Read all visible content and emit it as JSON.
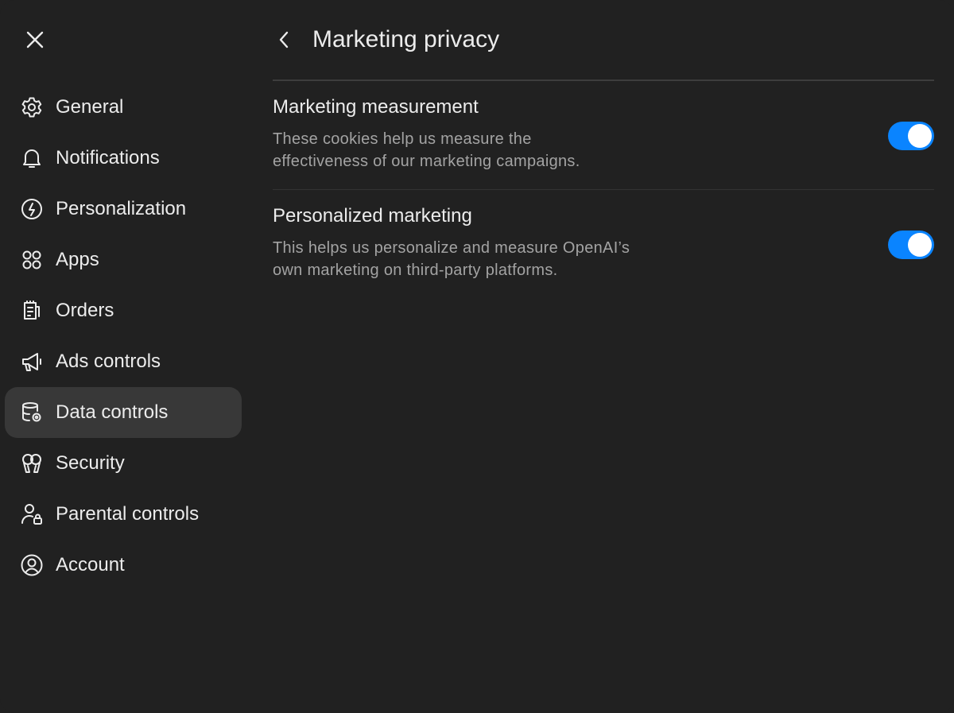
{
  "header": {
    "title": "Marketing privacy"
  },
  "sidebar": {
    "items": [
      {
        "label": "General",
        "icon": "gear-icon"
      },
      {
        "label": "Notifications",
        "icon": "bell-icon"
      },
      {
        "label": "Personalization",
        "icon": "personalization-icon"
      },
      {
        "label": "Apps",
        "icon": "apps-grid-icon"
      },
      {
        "label": "Orders",
        "icon": "receipt-icon"
      },
      {
        "label": "Ads controls",
        "icon": "megaphone-icon"
      },
      {
        "label": "Data controls",
        "icon": "database-gear-icon",
        "active": true
      },
      {
        "label": "Security",
        "icon": "security-icon"
      },
      {
        "label": "Parental controls",
        "icon": "parent-lock-icon"
      },
      {
        "label": "Account",
        "icon": "account-icon"
      }
    ]
  },
  "settings": [
    {
      "title": "Marketing measurement",
      "description_line1": "These cookies help us measure the",
      "description_line2": "effectiveness of our marketing campaigns.",
      "enabled": true
    },
    {
      "title": "Personalized marketing",
      "description_line1": "This helps us personalize and measure OpenAI’s",
      "description_line2": "own marketing on third-party platforms.",
      "enabled": true
    }
  ],
  "colors": {
    "background": "#212121",
    "active_item": "#383838",
    "toggle_on": "#0a84ff",
    "text_primary": "#ececec",
    "text_secondary": "#a3a3a3"
  }
}
